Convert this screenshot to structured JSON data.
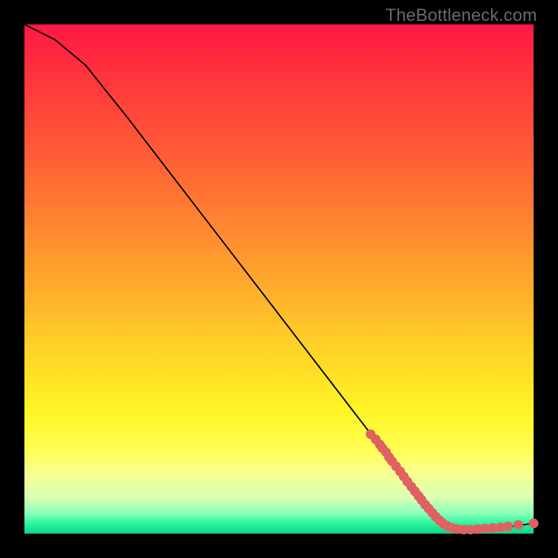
{
  "watermark": "TheBottleneck.com",
  "chart_data": {
    "type": "line",
    "title": "",
    "xlabel": "",
    "ylabel": "",
    "xlim": [
      0,
      100
    ],
    "ylim": [
      0,
      100
    ],
    "curve": [
      {
        "x": 0,
        "y": 100
      },
      {
        "x": 6,
        "y": 97
      },
      {
        "x": 12,
        "y": 92
      },
      {
        "x": 20,
        "y": 82
      },
      {
        "x": 30,
        "y": 69
      },
      {
        "x": 40,
        "y": 56
      },
      {
        "x": 50,
        "y": 43
      },
      {
        "x": 60,
        "y": 30
      },
      {
        "x": 70,
        "y": 17
      },
      {
        "x": 78,
        "y": 6
      },
      {
        "x": 82,
        "y": 2
      },
      {
        "x": 85,
        "y": 1
      },
      {
        "x": 90,
        "y": 1
      },
      {
        "x": 95,
        "y": 1.3
      },
      {
        "x": 100,
        "y": 2
      }
    ],
    "dots": [
      {
        "x": 68,
        "y": 19.5
      },
      {
        "x": 69,
        "y": 18.5
      },
      {
        "x": 69.8,
        "y": 17.5
      },
      {
        "x": 70.3,
        "y": 16.8
      },
      {
        "x": 71,
        "y": 16
      },
      {
        "x": 71.6,
        "y": 15
      },
      {
        "x": 72.2,
        "y": 14.2
      },
      {
        "x": 73,
        "y": 13.2
      },
      {
        "x": 73.8,
        "y": 12.2
      },
      {
        "x": 74.5,
        "y": 11.2
      },
      {
        "x": 75.2,
        "y": 10.2
      },
      {
        "x": 76,
        "y": 9.2
      },
      {
        "x": 76.7,
        "y": 8.3
      },
      {
        "x": 77.4,
        "y": 7.4
      },
      {
        "x": 78,
        "y": 6.6
      },
      {
        "x": 78.7,
        "y": 5.7
      },
      {
        "x": 79.4,
        "y": 4.9
      },
      {
        "x": 80.1,
        "y": 4.1
      },
      {
        "x": 80.8,
        "y": 3.3
      },
      {
        "x": 81.5,
        "y": 2.6
      },
      {
        "x": 82.2,
        "y": 2.0
      },
      {
        "x": 83,
        "y": 1.5
      },
      {
        "x": 84,
        "y": 1.1
      },
      {
        "x": 85,
        "y": 0.9
      },
      {
        "x": 86.3,
        "y": 0.8
      },
      {
        "x": 87.6,
        "y": 0.8
      },
      {
        "x": 89,
        "y": 0.9
      },
      {
        "x": 90.4,
        "y": 1.0
      },
      {
        "x": 92,
        "y": 1.1
      },
      {
        "x": 93.5,
        "y": 1.2
      },
      {
        "x": 95,
        "y": 1.4
      },
      {
        "x": 97,
        "y": 1.7
      },
      {
        "x": 100,
        "y": 2.0
      }
    ]
  }
}
